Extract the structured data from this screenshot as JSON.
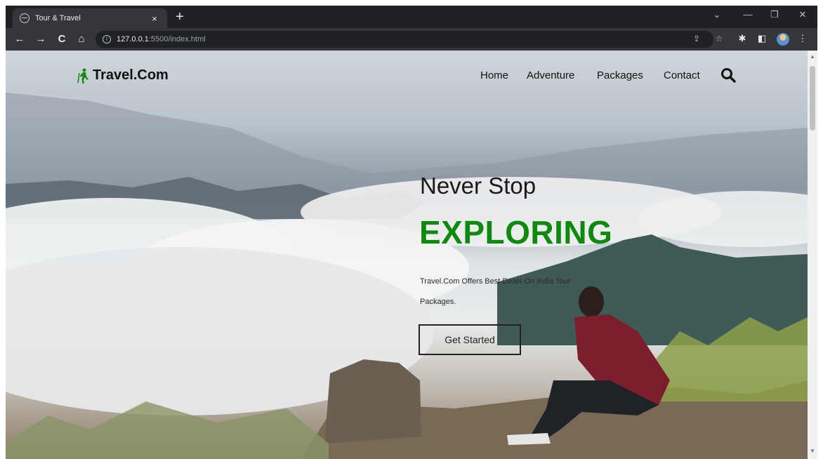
{
  "browser": {
    "tab_title": "Tour & Travel",
    "tab_close": "×",
    "new_tab": "+",
    "url_host": "127.0.0.1",
    "url_path": ":5500/index.html",
    "window_controls": {
      "menu": "⌄",
      "minimize": "—",
      "restore": "❐",
      "close": "✕"
    },
    "nav": {
      "back": "←",
      "forward": "→",
      "reload": "C",
      "home": "⌂"
    }
  },
  "site": {
    "logo_text": "Travel.Com",
    "nav_links": [
      "Home",
      "Adventure",
      "Packages",
      "Contact"
    ],
    "hero": {
      "subtitle": "Never Stop",
      "title": "EXPLORING",
      "description": "Travel.Com Offers Best Deals On India Tour Packages.",
      "cta_label": "Get Started"
    }
  },
  "colors": {
    "accent_green": "#0f8a0f",
    "chrome_dark": "#202124",
    "chrome_toolbar": "#35363a"
  },
  "icons": [
    "globe-icon",
    "info-icon",
    "share-icon",
    "star-icon",
    "puzzle-icon",
    "sidebar-icon",
    "hiker-icon",
    "search-icon"
  ]
}
